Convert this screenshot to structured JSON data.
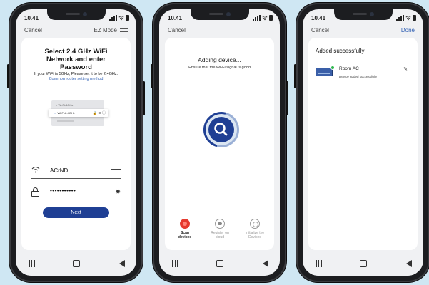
{
  "status": {
    "time": "10.41"
  },
  "phone1": {
    "nav_left": "Cancel",
    "nav_right": "EZ Mode",
    "title": "Select 2.4 GHz WiFi\nNetwork and enter\nPassword",
    "hint_text": "If your WiFi is 5GHz, Please set it to be 2.4GHz.",
    "hint_link": "Common router setting method",
    "illustration": {
      "row1": "Wi-Fi-5GHz",
      "row2": "Wi-Fi-2.4GHz"
    },
    "ssid_value": "ACrND",
    "password_value": "•••••••••••",
    "next_button": "Next"
  },
  "phone2": {
    "nav_left": "Cancel",
    "heading": "Adding device...",
    "subheading": "Ensure that the Wi-Fi signal is good",
    "steps": [
      {
        "label": "Scan\ndevices"
      },
      {
        "label": "Register on\ncloud"
      },
      {
        "label": "Initialize the\nDevices"
      }
    ]
  },
  "phone3": {
    "nav_left": "Cancel",
    "nav_right": "Done",
    "heading": "Added successfully",
    "device_name": "Room AC",
    "device_sub": "Device added successfully"
  },
  "colors": {
    "accent": "#1f3f94",
    "link": "#2f5fb3",
    "active_step": "#e53a2f",
    "success": "#2eb84d"
  }
}
